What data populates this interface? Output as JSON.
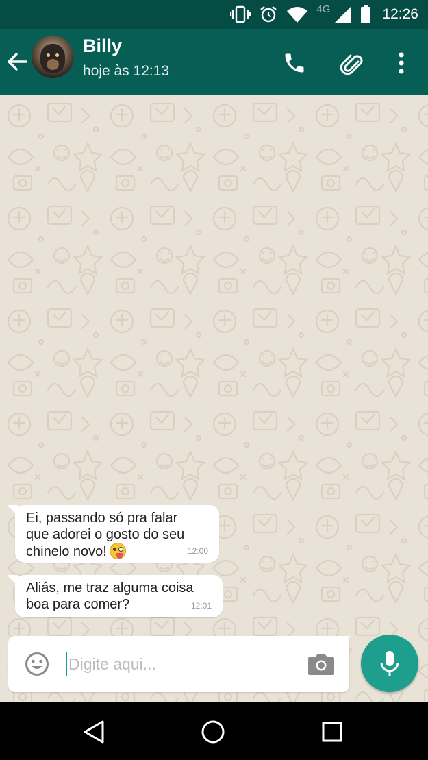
{
  "status_bar": {
    "network": "4G",
    "time": "12:26",
    "icons": [
      "vibrate-icon",
      "alarm-icon",
      "wifi-icon",
      "signal-icon",
      "battery-icon"
    ]
  },
  "header": {
    "contact_name": "Billy",
    "last_seen": "hoje às 12:13",
    "actions": [
      "phone-icon",
      "attach-icon",
      "more-vert-icon"
    ]
  },
  "messages": [
    {
      "text": "Ei, passando só pra falar\nque adorei o gosto do seu\nchinelo novo!",
      "emoji": "winking-face-with-tongue",
      "time": "12:00",
      "direction": "incoming"
    },
    {
      "text": "Aliás, me traz alguma coisa\nboa para comer?",
      "time": "12:01",
      "direction": "incoming"
    }
  ],
  "composer": {
    "placeholder": "Digite aqui...",
    "value": ""
  },
  "nav_bar": [
    "back-triangle-icon",
    "home-circle-icon",
    "recents-square-icon"
  ],
  "colors": {
    "status_bar": "#054d44",
    "app_bar": "#075e54",
    "accent": "#1e9e8c",
    "chat_background": "#e9e2d6",
    "bubble": "#ffffff"
  }
}
